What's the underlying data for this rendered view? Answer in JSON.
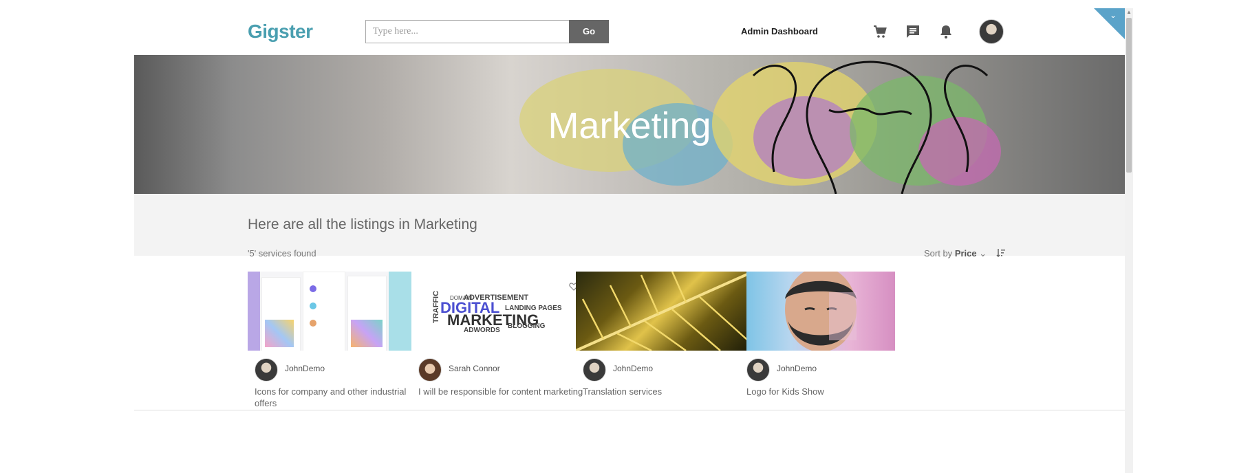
{
  "header": {
    "logo": "Gigster",
    "search_placeholder": "Type here...",
    "go_label": "Go",
    "admin_link": "Admin Dashboard",
    "icons": [
      "cart-icon",
      "chat-icon",
      "bell-icon",
      "avatar"
    ]
  },
  "banner": {
    "title": "Marketing"
  },
  "listing": {
    "heading": "Here are all the listings in Marketing",
    "count": "'5' services found",
    "sort_prefix": "Sort by",
    "sort_value": "Price"
  },
  "cards": [
    {
      "author": "JohnDemo",
      "title": "Icons for company and other industrial offers"
    },
    {
      "author": "Sarah Connor",
      "title": "I will be responsible for content marketing"
    },
    {
      "author": "JohnDemo",
      "title": "Translation services"
    },
    {
      "author": "JohnDemo",
      "title": "Logo for Kids Show"
    }
  ],
  "wordcloud": {
    "w1": "ADVERTISEMENT",
    "w2": "DIGITAL",
    "w3": "MARKETING",
    "w4": "TRAFFIC",
    "w5": "LANDING PAGES",
    "w6": "ADWORDS",
    "w7": "BLOGGING",
    "w8": "DOMAIN"
  },
  "colors": {
    "accent": "#5ba3c9",
    "brand": "#2ea89b",
    "go_button": "#666666"
  }
}
